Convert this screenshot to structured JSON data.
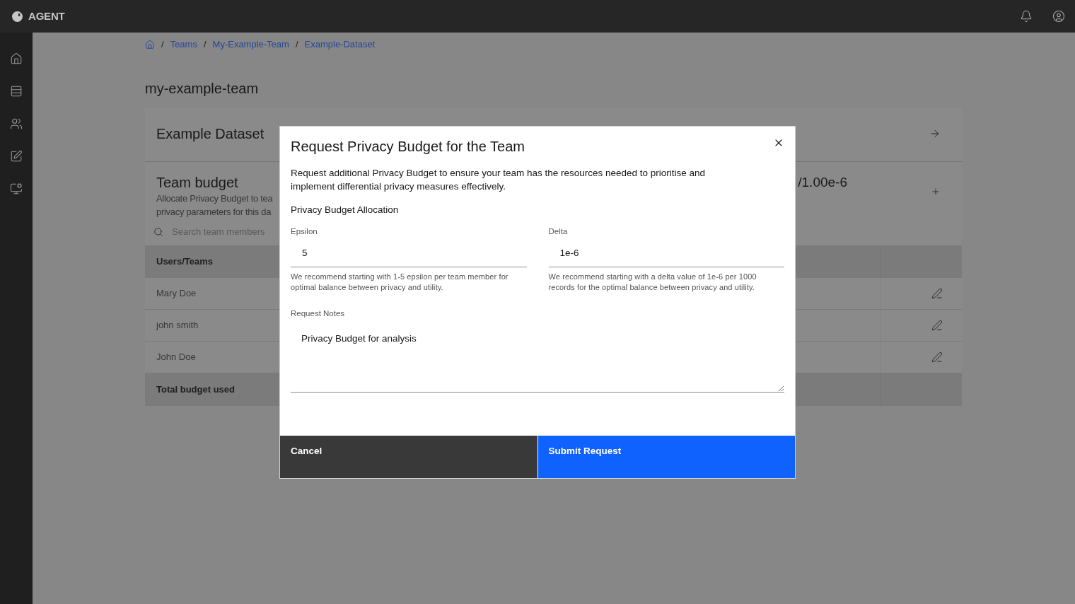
{
  "header": {
    "brand": "AGENT"
  },
  "breadcrumb": [
    {
      "separator": "/",
      "label": "Teams"
    },
    {
      "separator": "/",
      "label": "My-Example-Team"
    },
    {
      "separator": "/",
      "label": "Example-Dataset"
    }
  ],
  "page_title": "my-example-team",
  "dataset": {
    "title": "Example Dataset"
  },
  "team_budget": {
    "title": "Team budget",
    "description_lines": [
      "Allocate Privacy Budget to tea",
      "privacy parameters for this da"
    ],
    "value": "/1.00e-6",
    "search": {
      "placeholder": "Search team members"
    }
  },
  "table": {
    "columns": [
      "Users/Teams"
    ],
    "rows": [
      {
        "name": "Mary Doe"
      },
      {
        "name": "john smith"
      },
      {
        "name": "John Doe"
      }
    ],
    "footer": {
      "label": "Total budget used"
    }
  },
  "modal": {
    "title": "Request Privacy Budget for the Team",
    "description": "Request additional Privacy Budget to ensure your team has the resources needed to prioritise and implement differential privacy measures effectively.",
    "section_label": "Privacy Budget Allocation",
    "fields": [
      {
        "label": "Epsilon",
        "value": "5",
        "helper": "We recommend starting with 1-5 epsilon per team member for optimal balance between privacy and utility."
      },
      {
        "label": "Delta",
        "value": "1e-6",
        "helper": "We recommend starting with a delta value of 1e-6 per 1000 records for the optimal balance between privacy and utility."
      }
    ],
    "notes": {
      "label": "Request Notes",
      "value": "Privacy Budget for analysis"
    },
    "buttons": [
      {
        "label": "Cancel",
        "kind": "secondary"
      },
      {
        "label": "Submit Request",
        "kind": "primary"
      }
    ]
  }
}
